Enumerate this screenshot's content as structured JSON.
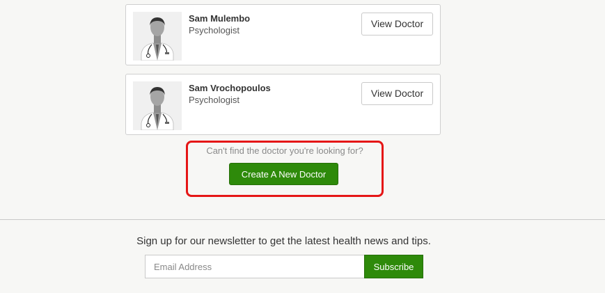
{
  "doctors": [
    {
      "name": "Sam Mulembo",
      "specialty": "Psychologist",
      "button_label": "View Doctor",
      "avatar_icon": "doctor-avatar-icon"
    },
    {
      "name": "Sam Vrochopoulos",
      "specialty": "Psychologist",
      "button_label": "View Doctor",
      "avatar_icon": "doctor-avatar-icon"
    }
  ],
  "cant_find": {
    "text": "Can't find the doctor you're looking for?",
    "button_label": "Create A New Doctor",
    "highlight_color": "#e51616"
  },
  "newsletter": {
    "text": "Sign up for our newsletter to get the latest health news and tips.",
    "email_placeholder": "Email Address",
    "email_value": "",
    "subscribe_label": "Subscribe"
  },
  "colors": {
    "primary_green": "#2e8a0a",
    "background": "#f7f7f5"
  }
}
